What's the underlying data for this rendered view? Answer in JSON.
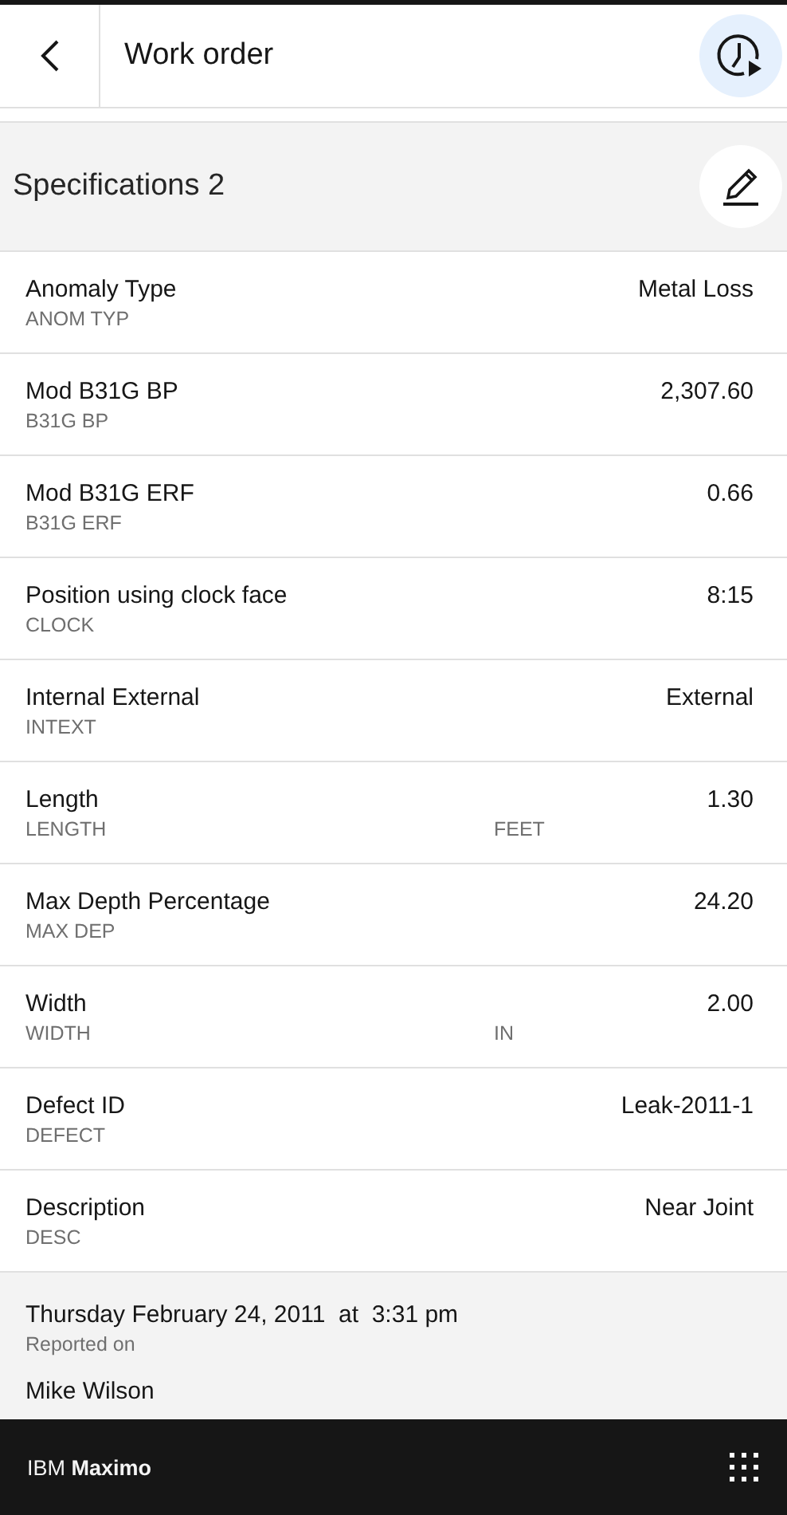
{
  "header": {
    "title": "Work order"
  },
  "section": {
    "title": "Specifications 2"
  },
  "specs": [
    {
      "label": "Anomaly Type",
      "attribute": "ANOM TYP",
      "value": "Metal Loss"
    },
    {
      "label": "Mod B31G BP",
      "attribute": "B31G BP",
      "value": "2,307.60"
    },
    {
      "label": "Mod B31G ERF",
      "attribute": "B31G ERF",
      "value": "0.66"
    },
    {
      "label": "Position using clock face",
      "attribute": "CLOCK",
      "value": "8:15"
    },
    {
      "label": "Internal External",
      "attribute": "INTEXT",
      "value": "External"
    },
    {
      "label": "Length",
      "attribute": "LENGTH",
      "unit": "FEET",
      "value": "1.30"
    },
    {
      "label": "Max Depth Percentage",
      "attribute": "MAX DEP",
      "value": "24.20"
    },
    {
      "label": "Width",
      "attribute": "WIDTH",
      "unit": "IN",
      "value": "2.00"
    },
    {
      "label": "Defect ID",
      "attribute": "DEFECT",
      "value": "Leak-2011-1"
    },
    {
      "label": "Description",
      "attribute": "DESC",
      "value": "Near Joint"
    }
  ],
  "reported": {
    "date": "Thursday February 24, 2011  at  3:31 pm",
    "label": "Reported on",
    "by": "Mike Wilson"
  },
  "footer": {
    "brand": "IBM",
    "product": "Maximo"
  }
}
